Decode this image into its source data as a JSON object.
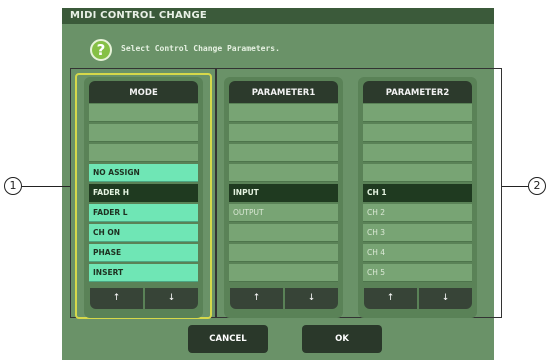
{
  "window": {
    "title": "MIDI CONTROL CHANGE"
  },
  "help": {
    "icon": "question-icon",
    "glyph": "?",
    "text": "Select Control Change Parameters."
  },
  "columns": [
    {
      "header": "MODE",
      "items": [
        "",
        "",
        "",
        "NO ASSIGN",
        "FADER H",
        "FADER L",
        "CH ON",
        "PHASE",
        "INSERT"
      ],
      "up": "↑",
      "down": "↓"
    },
    {
      "header": "PARAMETER1",
      "items": [
        "",
        "",
        "",
        "",
        "INPUT",
        "OUTPUT",
        "",
        "",
        ""
      ],
      "up": "↑",
      "down": "↓"
    },
    {
      "header": "PARAMETER2",
      "items": [
        "",
        "",
        "",
        "",
        "CH 1",
        "CH 2",
        "CH 3",
        "CH 4",
        "CH 5"
      ],
      "up": "↑",
      "down": "↓"
    }
  ],
  "buttons": {
    "cancel": "CANCEL",
    "ok": "OK"
  },
  "callouts": {
    "one": "1",
    "two": "2"
  },
  "colors": {
    "accent": "#6fe6b5",
    "selected": "#1f3a20",
    "dialog": "#6a9268"
  }
}
